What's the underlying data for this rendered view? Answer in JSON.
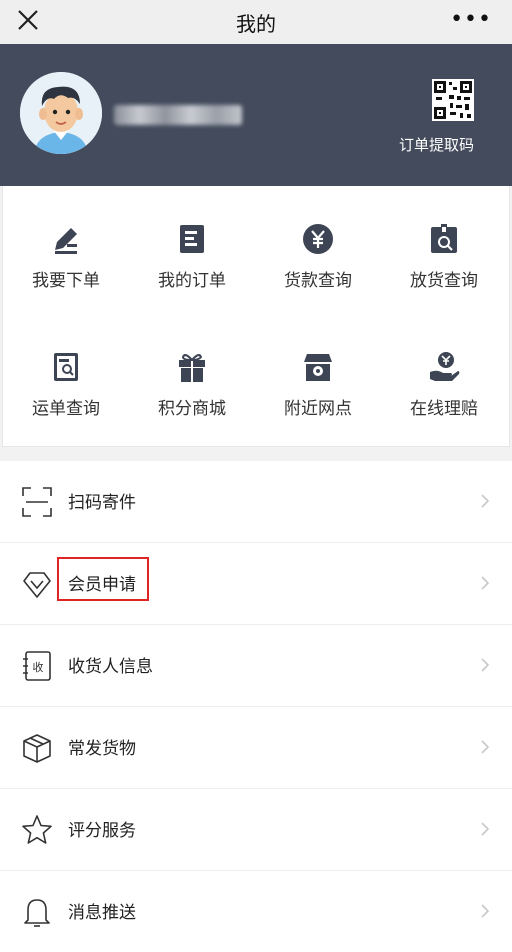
{
  "topbar": {
    "title": "我的",
    "more": "•••"
  },
  "header": {
    "qr_label": "订单提取码"
  },
  "grid": [
    {
      "label": "我要下单",
      "icon": "order-pen-icon"
    },
    {
      "label": "我的订单",
      "icon": "order-list-icon"
    },
    {
      "label": "货款查询",
      "icon": "yuan-circle-icon"
    },
    {
      "label": "放货查询",
      "icon": "box-search-icon"
    },
    {
      "label": "运单查询",
      "icon": "waybill-search-icon"
    },
    {
      "label": "积分商城",
      "icon": "gift-icon"
    },
    {
      "label": "附近网点",
      "icon": "store-icon"
    },
    {
      "label": "在线理赔",
      "icon": "hand-coin-icon"
    }
  ],
  "menu": [
    {
      "label": "扫码寄件",
      "icon": "scan-icon"
    },
    {
      "label": "会员申请",
      "icon": "diamond-icon"
    },
    {
      "label": "收货人信息",
      "icon": "receiver-icon"
    },
    {
      "label": "常发货物",
      "icon": "package-icon"
    },
    {
      "label": "评分服务",
      "icon": "star-icon"
    },
    {
      "label": "消息推送",
      "icon": "bell-icon"
    }
  ],
  "colors": {
    "header_bg": "#434b5c",
    "icon_dark": "#3d4454",
    "highlight": "#e02424"
  }
}
